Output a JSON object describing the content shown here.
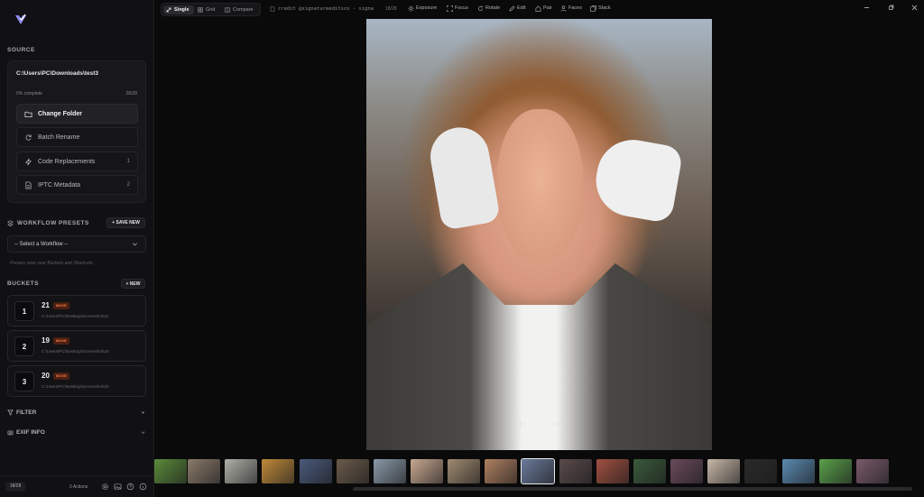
{
  "top": {
    "modes": [
      "Single",
      "Grid",
      "Compare"
    ],
    "filename": "credit @signatureeditsco - signa",
    "counter": "18/28",
    "tools": [
      "Exposure",
      "Focus",
      "Rotate",
      "Edit",
      "Pair",
      "Faces",
      "Stack"
    ]
  },
  "source": {
    "header": "SOURCE",
    "path": "C:\\Users\\PC\\Downloads\\test3",
    "progress_label": "0% complete",
    "progress_count": "28/28",
    "progress_value": 0,
    "change_folder": "Change Folder",
    "batch_rename": "Batch Rename",
    "code_replacements": "Code Replacements",
    "code_replacements_count": "1",
    "iptc": "IPTC Metadata",
    "iptc_count": "2"
  },
  "workflow": {
    "header": "WORKFLOW PRESETS",
    "save_new": "+ SAVE NEW",
    "select": "-- Select a Workflow --",
    "hint": "Presets save your Buckets and Shortcuts."
  },
  "buckets": {
    "header": "BUCKETS",
    "new": "+ NEW",
    "items": [
      {
        "key": "1",
        "name": "21",
        "badge": "MOVE",
        "path": "C:\\Users\\PC\\Desktop\\Screenshot\\21"
      },
      {
        "key": "2",
        "name": "19",
        "badge": "MOVE",
        "path": "C:\\Users\\PC\\Desktop\\Screenshot\\19"
      },
      {
        "key": "3",
        "name": "20",
        "badge": "MOVE",
        "path": "C:\\Users\\PC\\Desktop\\Screenshot\\20"
      }
    ]
  },
  "filter": "FILTER",
  "exif": "EXIF INFO",
  "footer": {
    "counter": "18/28",
    "actions": "0 Actions"
  },
  "colors": {
    "accent_badge": "#ff7a45",
    "background": "#0a0a0b",
    "sidebar": "#111113"
  },
  "thumbnails": [
    "#5a8a3a",
    "#8a7a6a",
    "#b0b0a8",
    "#c08a3a",
    "#4a5a7a",
    "#6a5a4a",
    "#8a9aa8",
    "#c8a890",
    "#a08a70",
    "#b08060",
    "#6a7a9a",
    "#5a4a4a",
    "#a05040",
    "#3a5a3a",
    "#6a4a5a",
    "#c8b8a8",
    "#2a2a2a",
    "#5a8ab0",
    "#5aa04a",
    "#7a5a6a"
  ]
}
